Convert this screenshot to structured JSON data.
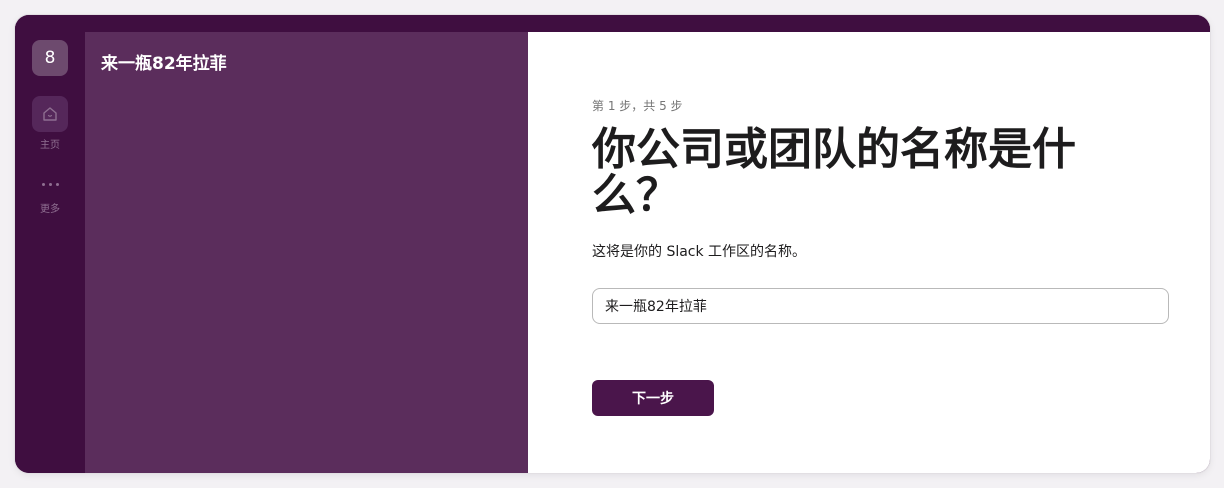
{
  "colors": {
    "aubergine": "#3f0e40",
    "sidebar": "#5b2d5c",
    "button": "#4a154b",
    "text": "#1d1c1d",
    "muted": "#767676"
  },
  "rail": {
    "workspace_initial": "8",
    "home": {
      "icon": "home-icon",
      "label": "主页"
    },
    "more": {
      "icon": "more-dots-icon",
      "label": "更多"
    }
  },
  "sidebar": {
    "workspace_name": "来一瓶82年拉菲"
  },
  "main": {
    "step_text": "第 1 步，共 5 步",
    "heading": "你公司或团队的名称是什么？",
    "description": "这将是你的 Slack 工作区的名称。",
    "name_input_value": "来一瓶82年拉菲",
    "next_button_label": "下一步"
  }
}
